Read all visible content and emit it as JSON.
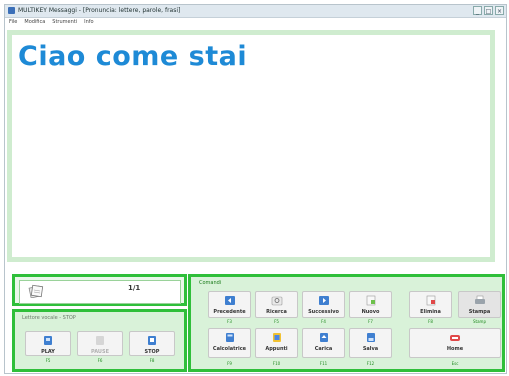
{
  "window": {
    "title": "MULTIKEY Messaggi - [Pronuncia: lettere, parole, frasi]",
    "controls": [
      "_",
      "□",
      "×"
    ]
  },
  "menu": [
    "File",
    "Modifica",
    "Strumenti",
    "Info"
  ],
  "editor": {
    "text": "Ciao come stai"
  },
  "page_counter": "1/1",
  "voice_reader": {
    "label": "Lettore vocale - STOP",
    "buttons": [
      {
        "label": "PLAY",
        "key": "F5",
        "icon": "play-icon"
      },
      {
        "label": "PAUSE",
        "key": "F6",
        "icon": "pause-icon",
        "disabled": true
      },
      {
        "label": "STOP",
        "key": "F8",
        "icon": "stop-icon"
      }
    ]
  },
  "commands": {
    "label": "Comandi",
    "row1": [
      {
        "label": "Precedente",
        "key": "F3",
        "icon": "previous-icon"
      },
      {
        "label": "Ricerca",
        "key": "F5",
        "icon": "search-icon"
      },
      {
        "label": "Successivo",
        "key": "F4",
        "icon": "next-icon"
      },
      {
        "label": "Nuovo",
        "key": "F7",
        "icon": "new-icon"
      },
      {
        "label": "Elimina",
        "key": "F8",
        "icon": "delete-icon"
      },
      {
        "label": "Stampa",
        "key": "Stamp",
        "icon": "print-icon"
      }
    ],
    "row2": [
      {
        "label": "Calcolatrice",
        "key": "F9",
        "icon": "calculator-icon"
      },
      {
        "label": "Appunti",
        "key": "F10",
        "icon": "notes-icon"
      },
      {
        "label": "Carica",
        "key": "F11",
        "icon": "load-icon"
      },
      {
        "label": "Salva",
        "key": "F12",
        "icon": "save-icon"
      },
      {
        "label": "Home",
        "key": "Esc",
        "icon": "home-icon"
      }
    ]
  },
  "colors": {
    "accent_green": "#2fbf3a",
    "panel_green": "#d9f2d9",
    "text_blue": "#1e8ad6",
    "keyhint_green": "#1f8a1f"
  }
}
